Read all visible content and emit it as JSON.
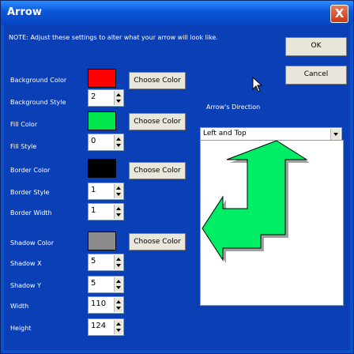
{
  "window": {
    "title": "Arrow",
    "close_label": "X"
  },
  "note": "NOTE: Adjust these settings to alter what your arrow will look like.",
  "buttons": {
    "ok": "OK",
    "cancel": "Cancel",
    "choose_color": "Choose Color"
  },
  "fields": {
    "background_color": {
      "label": "Background Color",
      "color": "#ff0000"
    },
    "background_style": {
      "label": "Background Style",
      "value": "2"
    },
    "fill_color": {
      "label": "Fill Color",
      "color": "#00e64c"
    },
    "fill_style": {
      "label": "Fill Style",
      "value": "0"
    },
    "border_color": {
      "label": "Border Color",
      "color": "#000000"
    },
    "border_style": {
      "label": "Border Style",
      "value": "1"
    },
    "border_width": {
      "label": "Border Width",
      "value": "1"
    },
    "shadow_color": {
      "label": "Shadow Color",
      "color": "#8c8c8c"
    },
    "shadow_x": {
      "label": "Shadow X",
      "value": "5"
    },
    "shadow_y": {
      "label": "Shadow Y",
      "value": "5"
    },
    "width": {
      "label": "Width",
      "value": "110"
    },
    "height": {
      "label": "Height",
      "value": "124"
    }
  },
  "direction": {
    "label": "Arrow's Direction",
    "selected": "Left and Top"
  },
  "colors": {
    "titlebar": "#0a56d8",
    "client_bg": "#0b3fb6",
    "arrow_fill": "#00ee66",
    "arrow_shadow": "#a0a0a0"
  }
}
